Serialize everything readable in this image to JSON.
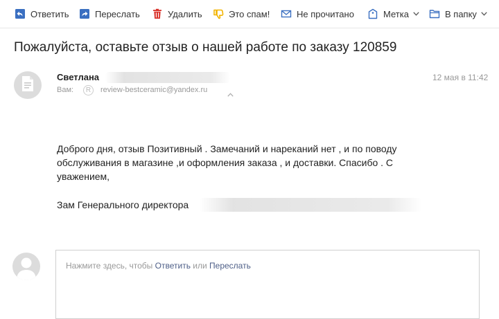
{
  "toolbar": {
    "reply_label": "Ответить",
    "forward_label": "Переслать",
    "delete_label": "Удалить",
    "spam_label": "Это спам!",
    "unread_label": "Не прочитано",
    "label_label": "Метка",
    "folder_label": "В папку"
  },
  "message": {
    "subject": "Пожалуйста, оставьте отзыв о нашей работе по заказу 120859",
    "sender_name": "Светлана",
    "to_label": "Вам:",
    "to_badge": "R",
    "to_email": "review-bestceramic@yandex.ru",
    "date": "12 мая в 11:42",
    "body_paragraph": "Доброго дня, отзыв Позитивный . Замечаний и нареканий нет , и по поводу  обслуживания в магазине ,и оформления заказа , и доставки.  Спасибо .  С уважением,",
    "signature": "Зам Генерального директора"
  },
  "reply": {
    "hint_prefix": "Нажмите здесь, чтобы ",
    "reply_link": "Ответить",
    "hint_or": " или ",
    "forward_link": "Переслать"
  },
  "colors": {
    "toolbar_icon_blue": "#3a6fc1",
    "delete_red": "#d9322b",
    "spam_yellow": "#f2b400",
    "link": "#4d5e87"
  },
  "icons": {
    "reply": "reply-arrow-icon",
    "forward": "forward-arrow-icon",
    "delete": "trash-icon",
    "spam": "thumb-down-icon",
    "unread": "envelope-icon",
    "label": "tag-icon",
    "folder": "folder-icon"
  }
}
